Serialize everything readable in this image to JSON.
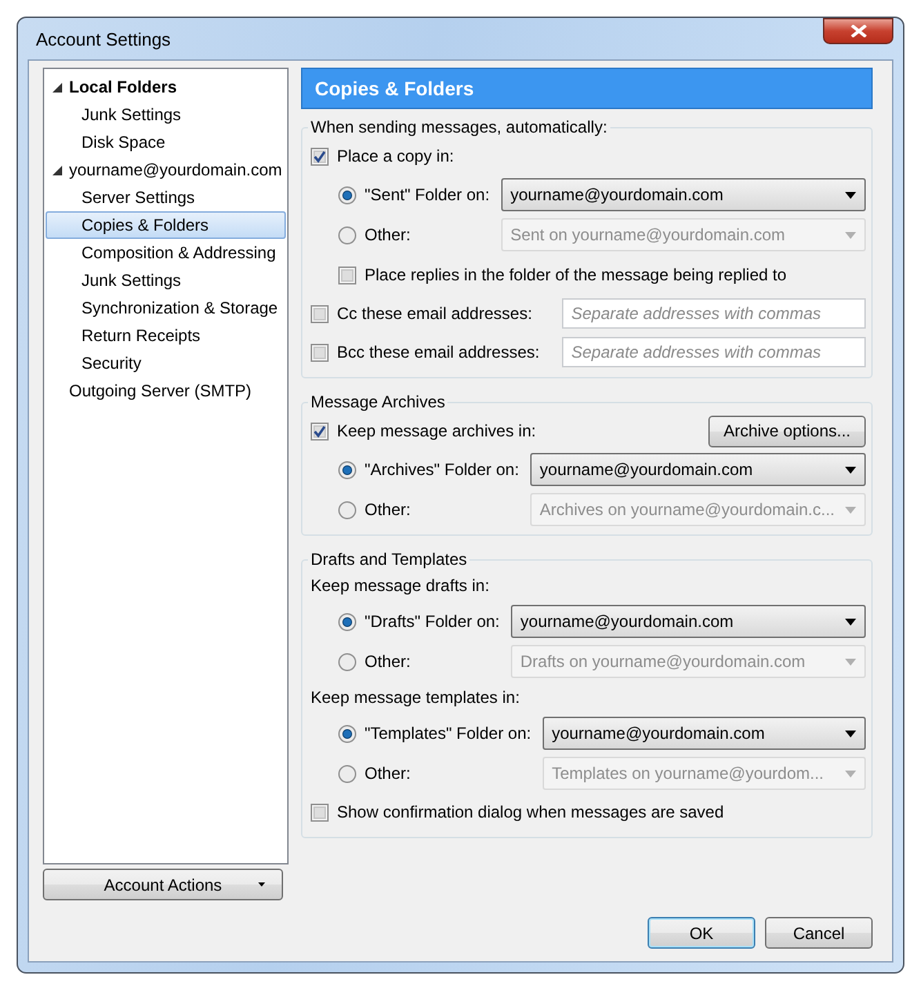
{
  "window": {
    "title": "Account Settings"
  },
  "sidebar": {
    "tree": [
      {
        "label": "Local Folders",
        "bold": true,
        "expanded": true,
        "selected": false,
        "children": [
          {
            "label": "Junk Settings",
            "selected": false
          },
          {
            "label": "Disk Space",
            "selected": false
          }
        ]
      },
      {
        "label": "yourname@yourdomain.com",
        "bold": false,
        "expanded": true,
        "selected": false,
        "children": [
          {
            "label": "Server Settings",
            "selected": false
          },
          {
            "label": "Copies & Folders",
            "selected": true
          },
          {
            "label": "Composition & Addressing",
            "selected": false
          },
          {
            "label": "Junk Settings",
            "selected": false
          },
          {
            "label": "Synchronization & Storage",
            "selected": false
          },
          {
            "label": "Return Receipts",
            "selected": false
          },
          {
            "label": "Security",
            "selected": false
          }
        ]
      },
      {
        "label": "Outgoing Server (SMTP)",
        "bold": false,
        "selected": false
      }
    ],
    "account_actions": "Account Actions"
  },
  "page": {
    "title": "Copies & Folders",
    "groups": [
      {
        "title": "When sending messages, automatically:",
        "rows": [
          {
            "kind": "checkbox",
            "label": "Place a copy in:",
            "checked": true,
            "children": [
              {
                "kind": "radio",
                "label": "\"Sent\" Folder on:",
                "selected": true,
                "value": "yourname@yourdomain.com",
                "disabled": false
              },
              {
                "kind": "radio",
                "label": "Other:",
                "selected": false,
                "value": "Sent on yourname@yourdomain.com",
                "disabled": true
              },
              {
                "kind": "checkbox",
                "label": "Place replies in the folder of the message being replied to",
                "checked": false
              }
            ]
          },
          {
            "kind": "field",
            "label": "Cc these email addresses:",
            "checked": false,
            "placeholder": "Separate addresses with commas"
          },
          {
            "kind": "field",
            "label": "Bcc these email addresses:",
            "checked": false,
            "placeholder": "Separate addresses with commas"
          }
        ]
      },
      {
        "title": "Message Archives",
        "rows": [
          {
            "kind": "checkbox",
            "label": "Keep message archives in:",
            "checked": true,
            "button": "Archive options...",
            "children": [
              {
                "kind": "radio",
                "label": "\"Archives\" Folder on:",
                "selected": true,
                "value": "yourname@yourdomain.com",
                "disabled": false
              },
              {
                "kind": "radio",
                "label": "Other:",
                "selected": false,
                "value": "Archives on yourname@yourdomain.c...",
                "disabled": true
              }
            ]
          }
        ]
      },
      {
        "title": "Drafts and Templates",
        "rows": [
          {
            "kind": "text",
            "label": "Keep message drafts in:",
            "children": [
              {
                "kind": "radio",
                "label": "\"Drafts\" Folder on:",
                "selected": true,
                "value": "yourname@yourdomain.com",
                "disabled": false
              },
              {
                "kind": "radio",
                "label": "Other:",
                "selected": false,
                "value": "Drafts on yourname@yourdomain.com",
                "disabled": true
              }
            ]
          },
          {
            "kind": "text",
            "label": "Keep message templates in:",
            "children": [
              {
                "kind": "radio",
                "label": "\"Templates\" Folder on:",
                "selected": true,
                "value": "yourname@yourdomain.com",
                "disabled": false
              },
              {
                "kind": "radio",
                "label": "Other:",
                "selected": false,
                "value": "Templates on yourname@yourdom...",
                "disabled": true
              }
            ]
          },
          {
            "kind": "checkbox",
            "label": "Show confirmation dialog when messages are saved",
            "checked": false
          }
        ]
      }
    ]
  },
  "buttons": [
    {
      "label": "OK",
      "default": true
    },
    {
      "label": "Cancel",
      "default": false
    }
  ]
}
